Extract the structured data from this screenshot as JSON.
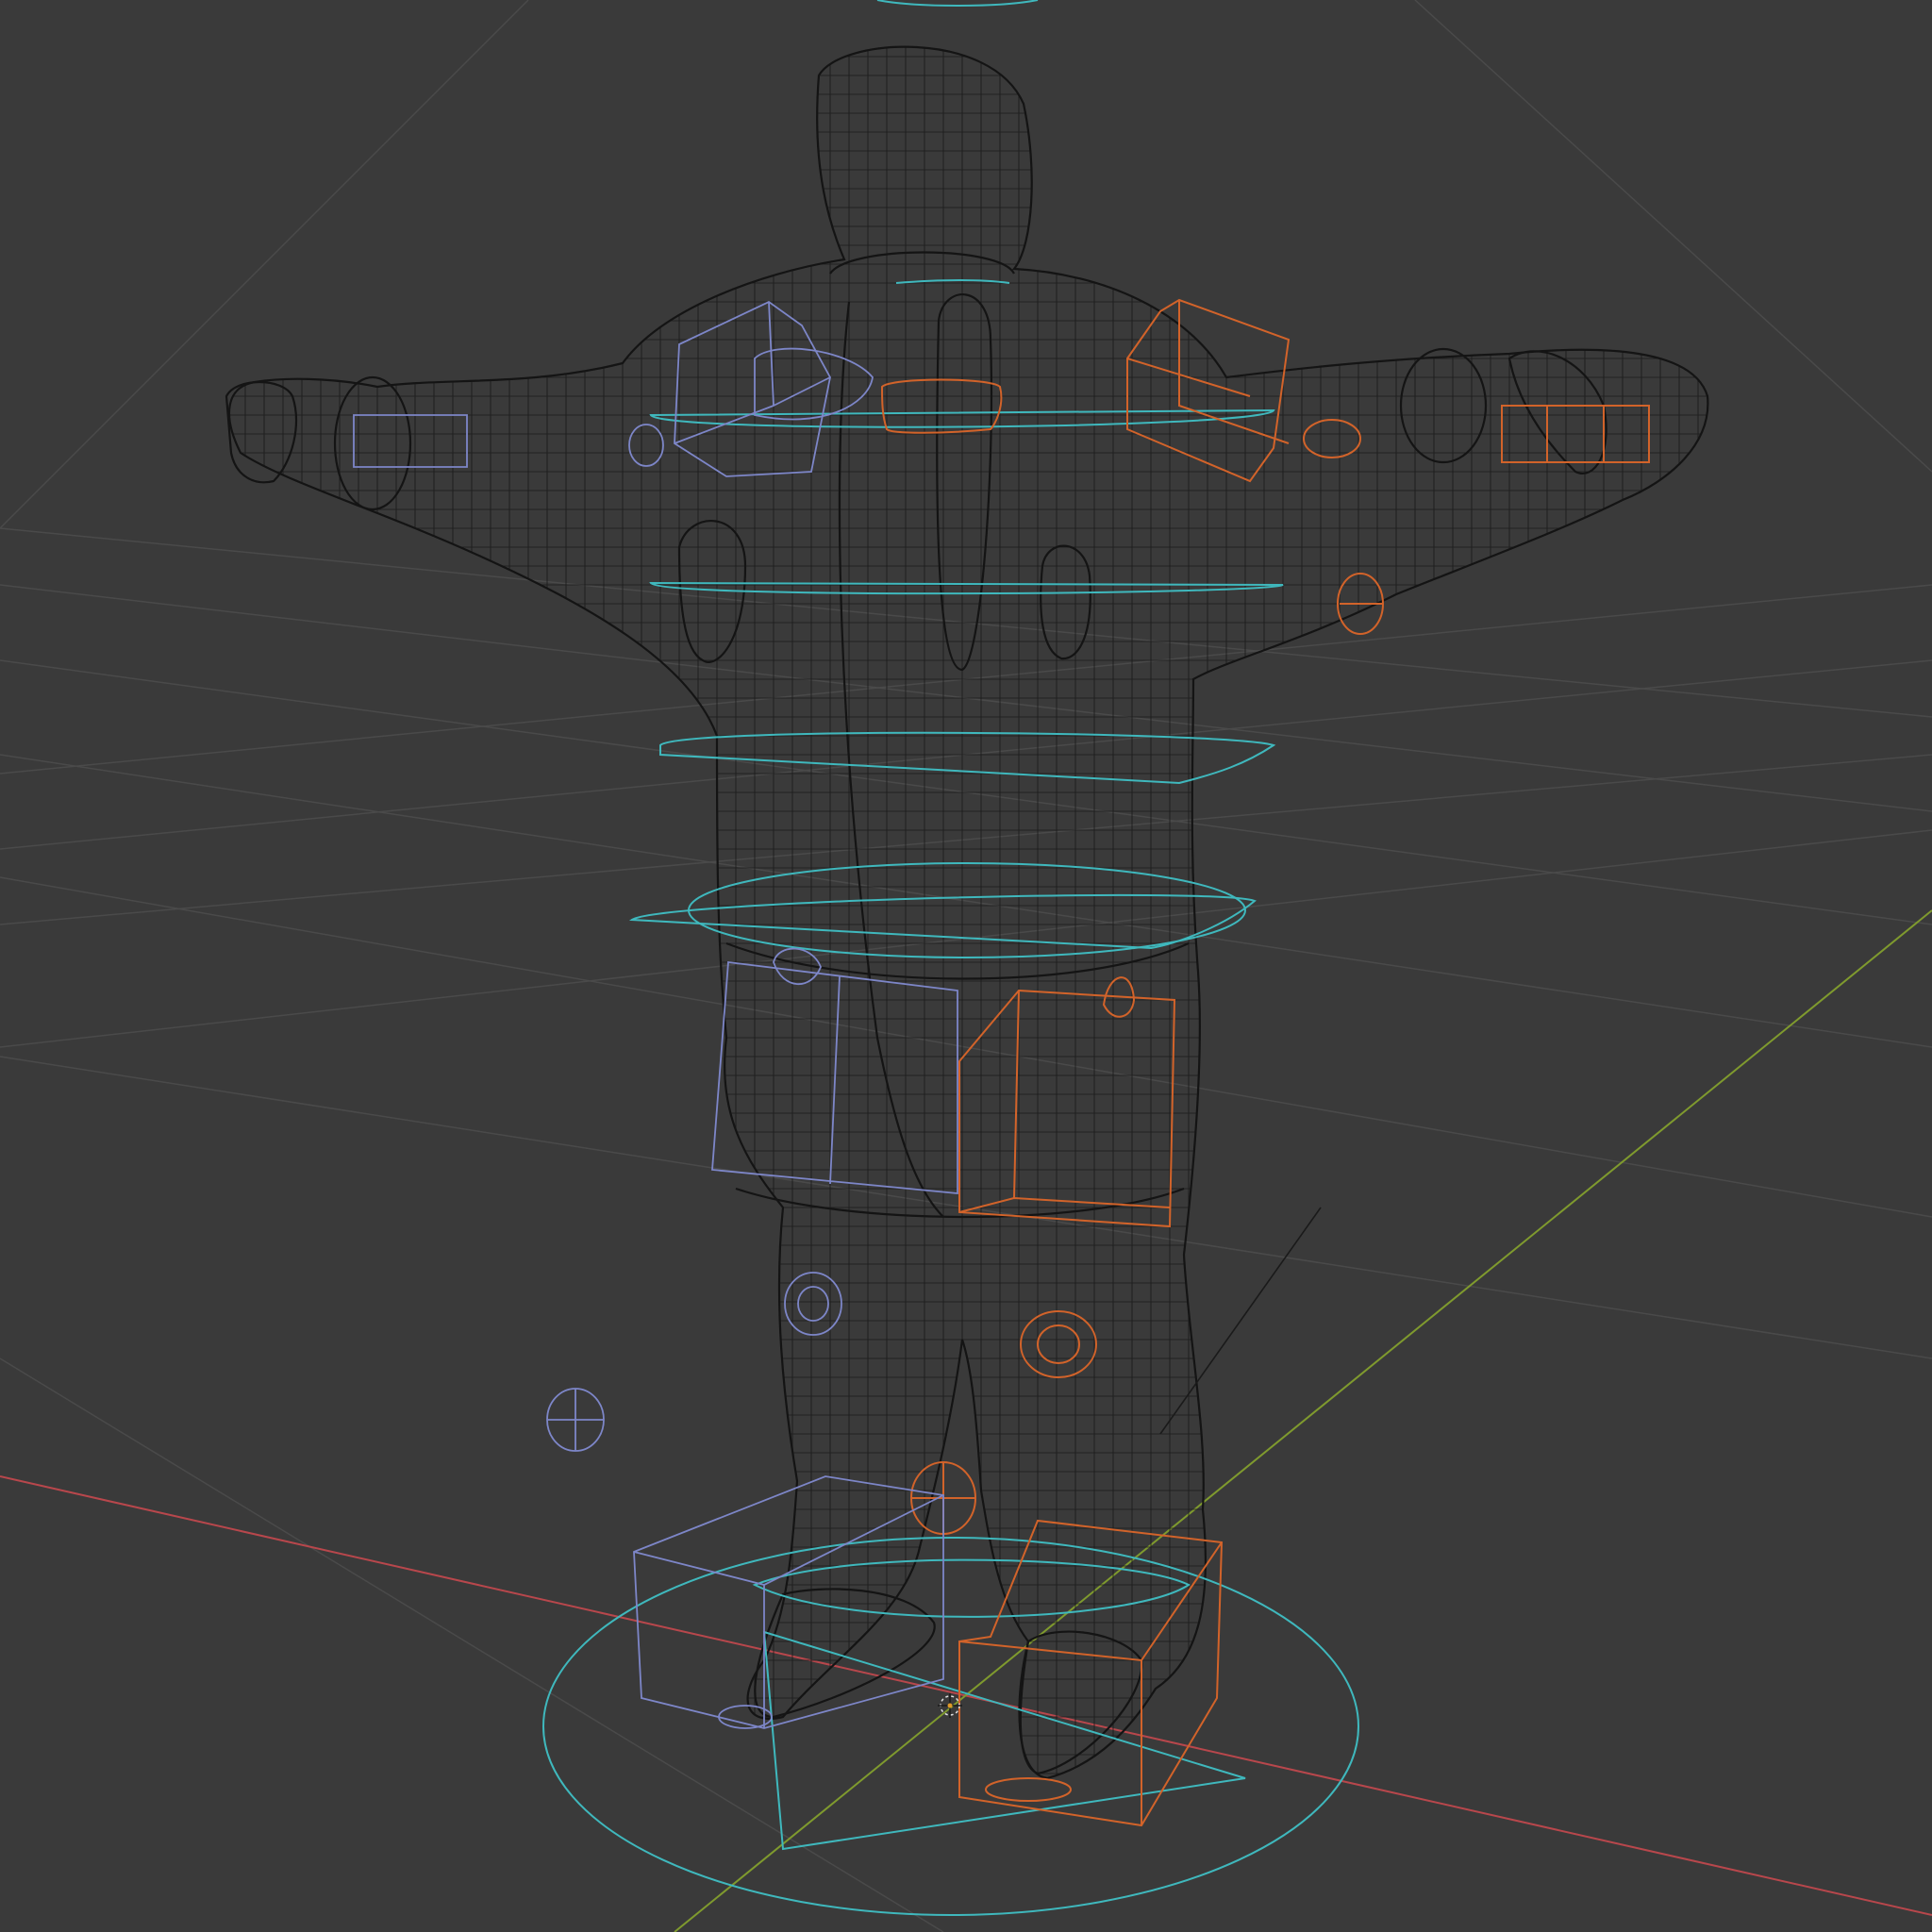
{
  "viewport": {
    "shading": "wireframe",
    "background": "#3a3a3a",
    "grid_color": "#4a4a4a",
    "x_axis_color": "#b8474c",
    "y_axis_color": "#7f9a2e",
    "mesh_color": "#141414",
    "controls": {
      "root_and_spine": "#3fb8bd",
      "left_side": "#d2632a",
      "right_side": "#7d86c8"
    }
  }
}
